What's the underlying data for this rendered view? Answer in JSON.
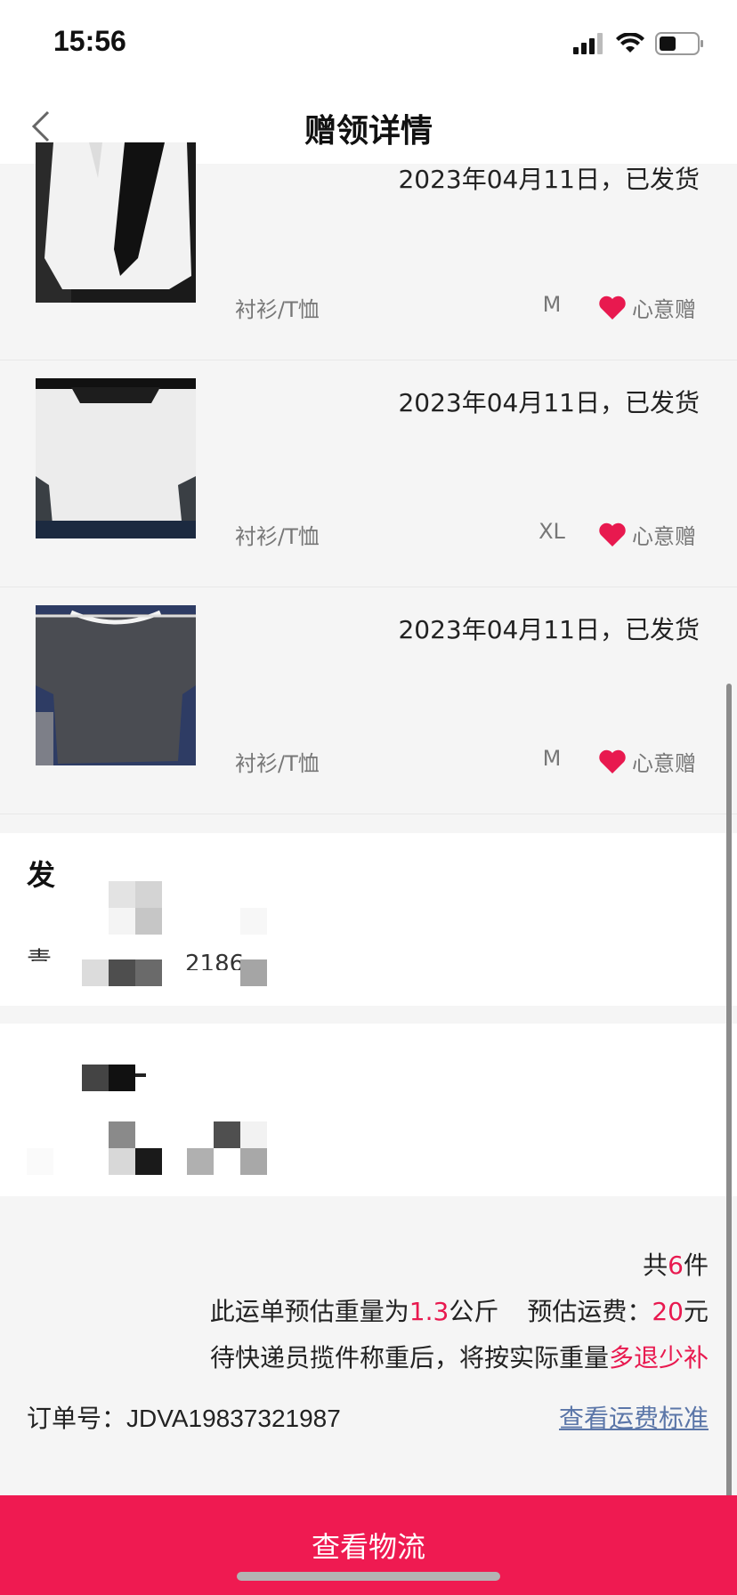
{
  "status_bar": {
    "time": "15:56"
  },
  "nav": {
    "title": "赠领详情"
  },
  "items": [
    {
      "date": "2023年04月11日，已发货",
      "category": "衬衫/T恤",
      "size": "M",
      "tag": "心意赠"
    },
    {
      "date": "2023年04月11日，已发货",
      "category": "衬衫/T恤",
      "size": "XL",
      "tag": "心意赠"
    },
    {
      "date": "2023年04月11日，已发货",
      "category": "衬衫/T恤",
      "size": "M",
      "tag": "心意赠"
    }
  ],
  "sender_block": {
    "label_fragment_1": "发",
    "label_fragment_2": "青",
    "code_fragment": "2186"
  },
  "summary": {
    "total_prefix": "共",
    "total_count": "6",
    "total_suffix": "件",
    "weight_prefix": "此运单预估重量为",
    "weight_value": "1.3",
    "weight_unit": "公斤",
    "fee_prefix": "预估运费：",
    "fee_value": "20",
    "fee_unit": "元",
    "note_prefix": "待快递员揽件称重后，将按实际重量",
    "note_highlight": "多退少补",
    "order_label": "订单号：",
    "order_number": "JDVA19837321987",
    "fee_link": "查看运费标准"
  },
  "bottom_button": "查看物流",
  "colors": {
    "accent": "#ef1a51",
    "link": "#5b76a8"
  }
}
